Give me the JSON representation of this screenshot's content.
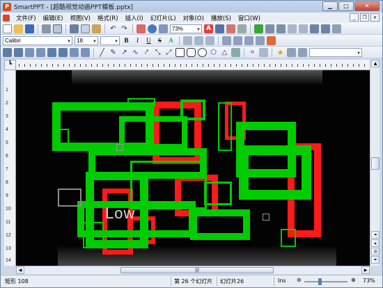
{
  "window": {
    "title": "SmartPPT - [超酷视觉动画PPT模板.pptx]"
  },
  "menubar": {
    "items": [
      "文件(F)",
      "编辑(E)",
      "视图(V)",
      "格式(R)",
      "插入(I)",
      "幻灯片(L)",
      "对象(O)",
      "播放(S)",
      "窗口(W)"
    ]
  },
  "toolbar": {
    "zoom_value": "73%",
    "font_name": "Calibri",
    "font_size": "18",
    "bold": "B",
    "italic": "I",
    "underline": "U",
    "strike": "S",
    "shadow": "A"
  },
  "ruler": {
    "vertical_ticks": [
      "1",
      "2",
      "3",
      "4",
      "5",
      "6",
      "7",
      "8",
      "9",
      "10",
      "11",
      "12",
      "13",
      "14"
    ]
  },
  "slide": {
    "visible_text": "Low"
  },
  "statusbar": {
    "shape_info": "矩形 108",
    "slide_position": "第 26 个幻灯片",
    "slide_name": "幻灯片26",
    "insert_mode": "Ins",
    "zoom": "73%"
  },
  "colors": {
    "green": "#00cc00",
    "red": "#ff1a1a",
    "accent": "#d84a22"
  }
}
